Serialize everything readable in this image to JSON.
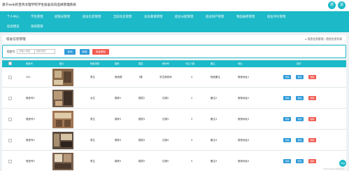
{
  "app": {
    "title": "基于web的宝鸡文理学院学生宿舍双向选择管理系统",
    "avatar_labels": [
      "游",
      "退"
    ]
  },
  "nav": {
    "items": [
      "个人中心",
      "学生管理",
      "宿管员管理",
      "宿舍信息管理",
      "当前舍友管理",
      "舍友邀请管理",
      "宿舍分配管理",
      "宿舍财产管理",
      "物品报修管理",
      "宿舍评价管理",
      "投诉建议",
      "系统管理"
    ]
  },
  "page": {
    "title": "宿舍信息管理",
    "breadcrumb": "宿舍信息管理 / 宿舍信息列表",
    "home_icon": "home-icon"
  },
  "search": {
    "field_label": "宿舍号",
    "field_placeholder": "请输入宿舍",
    "field2_placeholder": "宿舍类型",
    "query_button": "查询",
    "add_button": "新增",
    "batch_delete_button": "批量删除"
  },
  "table": {
    "headers": [
      "宿舍号",
      "图片",
      "宿舍类型",
      "楼栋",
      "楼层",
      "房间号",
      "可住人数",
      "备注",
      "地址",
      "操作"
    ],
    "rows": [
      {
        "room": "101",
        "type": "男生",
        "building": "宿舍楼",
        "floor": "1楼",
        "room_no": "学生宿舍间",
        "capacity": "4",
        "remark": "宿舍备注",
        "address": "宿舍地址1",
        "thumb": "#8b6a4a"
      },
      {
        "room": "宿舍号2",
        "type": "女生",
        "building": "楼栋2",
        "floor": "楼层2",
        "room_no": "住宿2",
        "capacity": "2",
        "remark": "备注2",
        "address": "宿舍地址2",
        "thumb": "#6f5a48"
      },
      {
        "room": "宿舍号3",
        "type": "男生",
        "building": "楼栋3",
        "floor": "楼层3",
        "room_no": "住宿3",
        "capacity": "3",
        "remark": "备注3",
        "address": "宿舍地址3",
        "thumb": "#a07654"
      },
      {
        "room": "宿舍号4",
        "type": "男生",
        "building": "楼栋4",
        "floor": "楼层4",
        "room_no": "住宿4",
        "capacity": "4",
        "remark": "备注4",
        "address": "宿舍地址4",
        "thumb": "#5d4c3f"
      },
      {
        "room": "宿舍号5",
        "type": "男生",
        "building": "楼栋5",
        "floor": "楼层5",
        "room_no": "住宿5",
        "capacity": "5",
        "remark": "备注5",
        "address": "宿舍地址5",
        "thumb": "#7a6250"
      }
    ],
    "actions": {
      "detail": "详情",
      "edit": "修改",
      "delete": "删除"
    }
  },
  "colors": {
    "accent": "#1cb9c8",
    "button_blue": "#2f9bd9",
    "button_red": "#f05b50"
  },
  "footer": {
    "float_button": "Top",
    "watermark": "CSDN @Java毕设项目"
  }
}
